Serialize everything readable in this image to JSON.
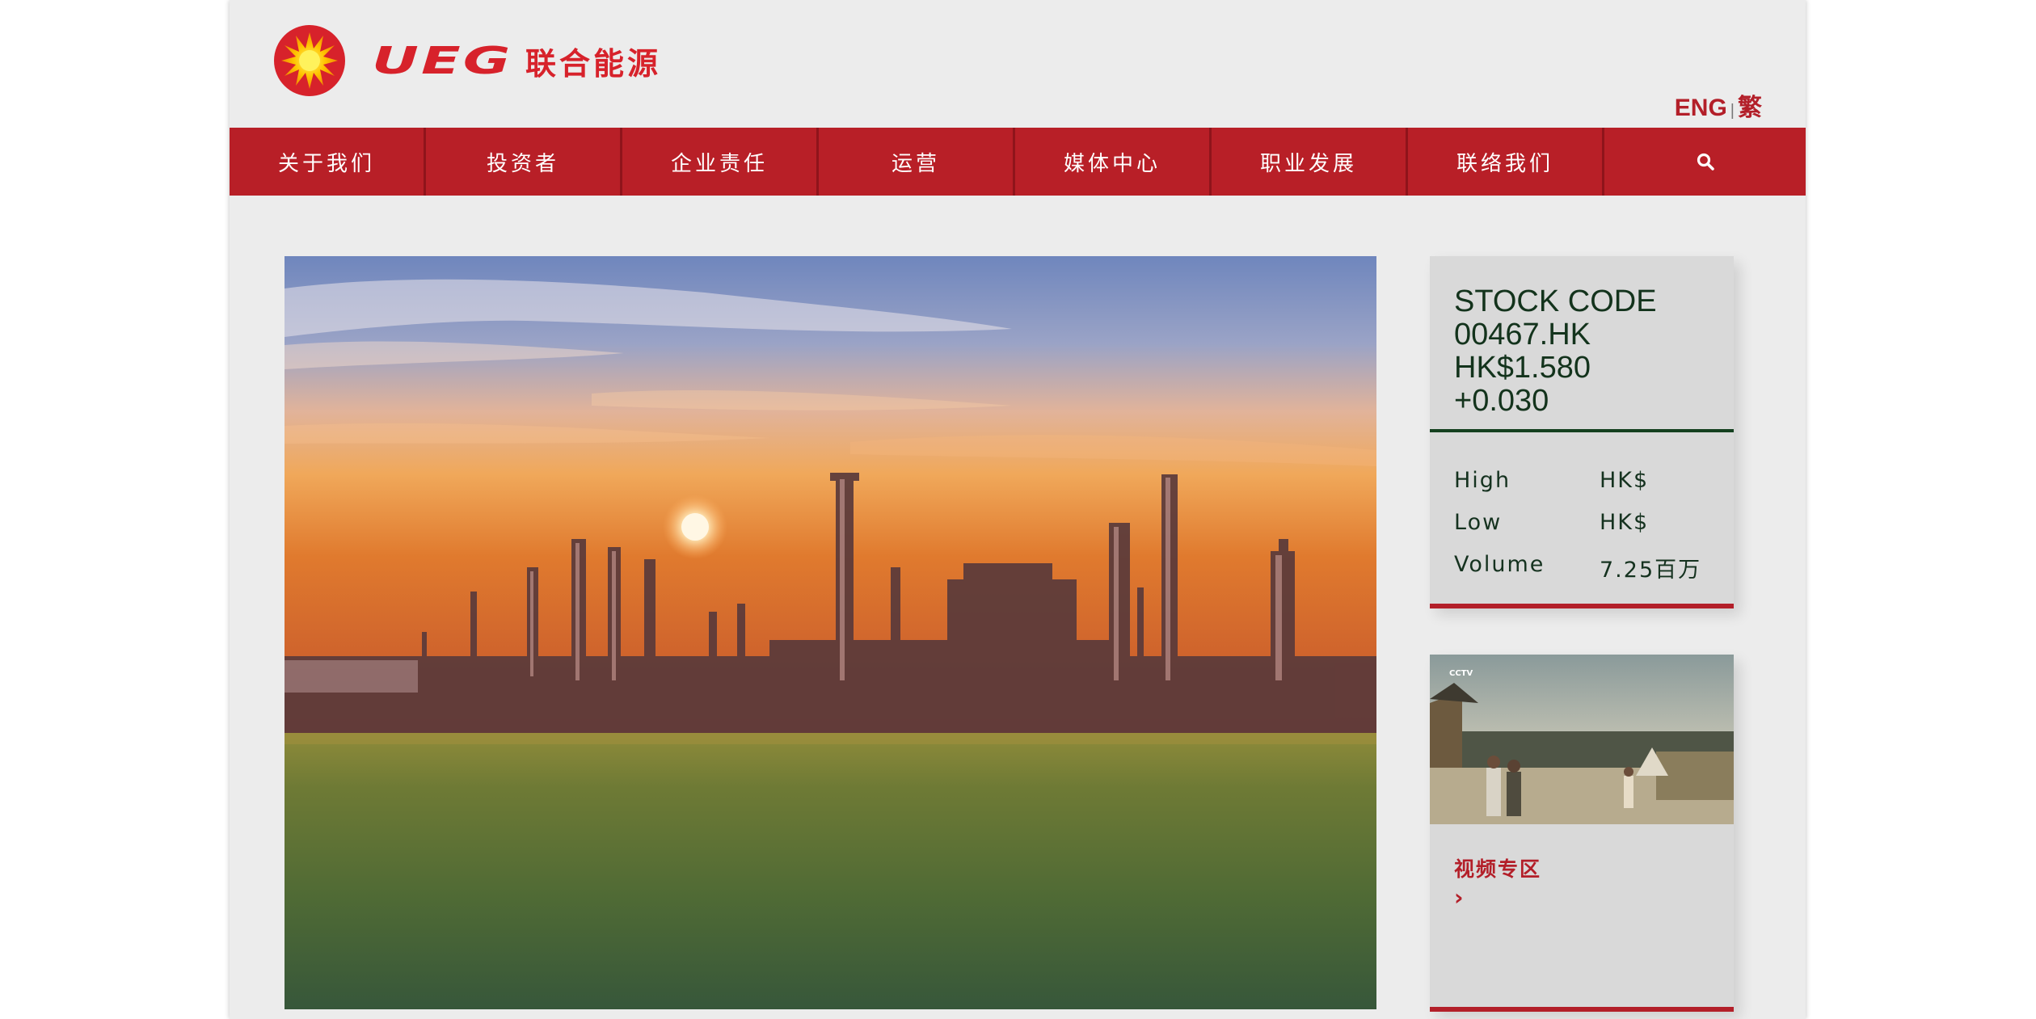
{
  "brand": {
    "logo_latin": "UEG",
    "logo_chinese": "联合能源"
  },
  "language": {
    "eng": "ENG",
    "separator": "|",
    "traditional": "繁"
  },
  "nav": {
    "items": [
      "关于我们",
      "投资者",
      "企业责任",
      "运营",
      "媒体中心",
      "职业发展",
      "联络我们"
    ],
    "search_icon": "search-icon"
  },
  "stock": {
    "title": "STOCK CODE",
    "code": "00467.HK",
    "price": "HK$1.580",
    "change": "+0.030",
    "rows": [
      {
        "label": "High",
        "value": "HK$"
      },
      {
        "label": "Low",
        "value": "HK$"
      },
      {
        "label": "Volume",
        "value": "7.25百万"
      }
    ]
  },
  "video": {
    "label": "视频专区",
    "arrow_icon": "chevron-right-icon"
  },
  "colors": {
    "brand_red": "#b81f27",
    "stock_green": "#14401f",
    "page_bg": "#ececec"
  }
}
